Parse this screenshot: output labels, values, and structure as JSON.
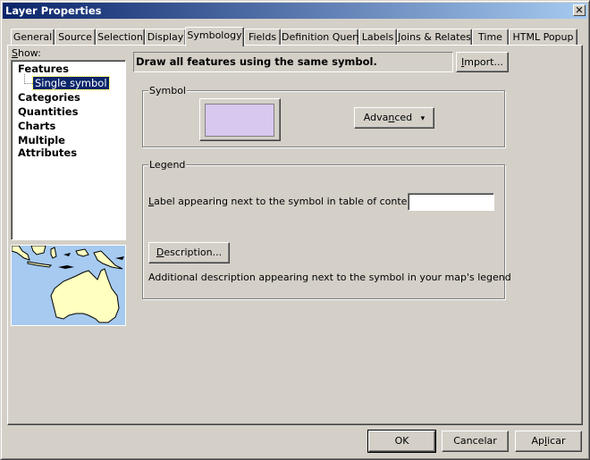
{
  "window": {
    "title": "Layer Properties",
    "close_glyph": "✕"
  },
  "tabs": [
    {
      "label": "General",
      "selected": false
    },
    {
      "label": "Source",
      "selected": false
    },
    {
      "label": "Selection",
      "selected": false
    },
    {
      "label": "Display",
      "selected": false
    },
    {
      "label": "Symbology",
      "selected": true
    },
    {
      "label": "Fields",
      "selected": false
    },
    {
      "label": "Definition Query",
      "selected": false
    },
    {
      "label": "Labels",
      "selected": false
    },
    {
      "label": "Joins & Relates",
      "selected": false
    },
    {
      "label": "Time",
      "selected": false
    },
    {
      "label": "HTML Popup",
      "selected": false
    }
  ],
  "show_panel": {
    "label_prefix": "S",
    "label_rest": "how:",
    "tree": {
      "features": "Features",
      "single_symbol": "Single symbol",
      "categories": "Categories",
      "quantities": "Quantities",
      "charts": "Charts",
      "multiple_attributes": "Multiple Attributes"
    },
    "preview_icon": "australia-map-preview"
  },
  "symbology": {
    "description": "Draw all features using the same symbol.",
    "import_button": {
      "u": "I",
      "rest": "mport..."
    },
    "symbol_group": {
      "title": "Symbol",
      "fill_color": "#d8c8f0",
      "advanced_button": {
        "pre": "Adva",
        "u": "n",
        "rest": "ced",
        "arrow": "▾"
      }
    },
    "legend_group": {
      "title": "Legend",
      "label_caption": {
        "u": "L",
        "rest": "abel appearing next to the symbol in table of contents:"
      },
      "label_value": "",
      "description_button": {
        "u": "D",
        "rest": "escription..."
      },
      "description_caption": "Additional description appearing next to the symbol in your map's legend"
    }
  },
  "footer": {
    "ok": "OK",
    "cancel": "Cancelar",
    "apply": {
      "pre": "Ap",
      "u": "l",
      "rest": "icar"
    }
  },
  "colors": {
    "title_start": "#0a246a",
    "title_end": "#a6caf0",
    "face": "#d4d0c8",
    "selection": "#0a246a",
    "map_water": "#a6caf0",
    "map_land": "#ffffc0"
  }
}
